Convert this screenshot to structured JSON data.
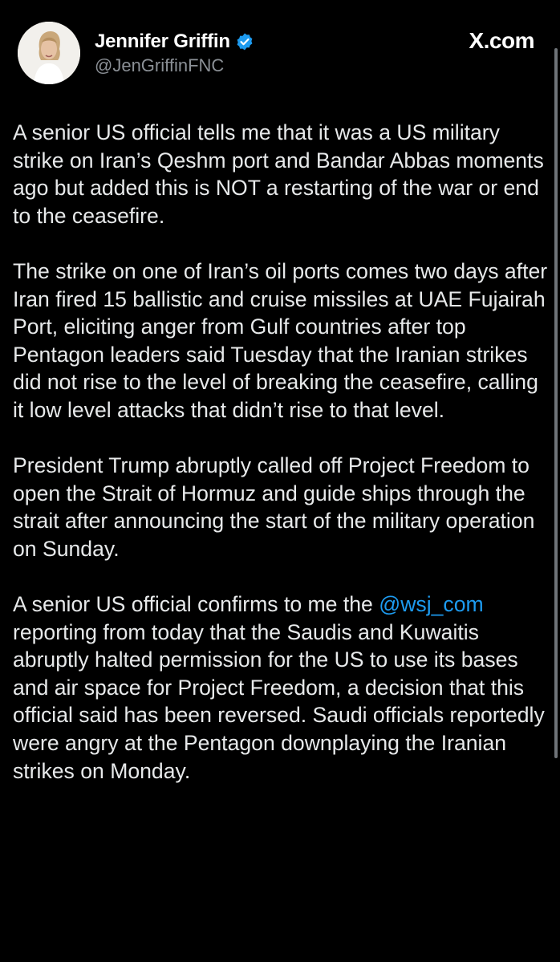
{
  "author": {
    "display_name": "Jennifer Griffin",
    "handle": "@JenGriffinFNC",
    "verified": true
  },
  "site": "X.com",
  "icons": {
    "verified": "verified-badge-icon",
    "avatar": "profile-photo"
  },
  "colors": {
    "background": "#000000",
    "text": "#e7e9ea",
    "secondary": "#8b9096",
    "link": "#1d9bf0",
    "verified": "#1d9bf0"
  },
  "tweet": {
    "p1": "A senior US official tells me that it was a US military strike on Iran’s Qeshm port and Bandar Abbas moments ago but added this is NOT a restarting of the war or end to the ceasefire.",
    "p2": "The strike on one of Iran’s oil ports comes two days after Iran fired 15 ballistic and cruise missiles at UAE Fujairah Port, eliciting anger from Gulf countries after top Pentagon leaders said Tuesday that the Iranian strikes did not rise to the level of breaking the ceasefire, calling it low level attacks that didn’t rise to that level.",
    "p3": "President Trump abruptly called off Project Freedom to open the Strait of Hormuz and guide ships through the strait after announcing the start of the military operation on Sunday.",
    "p4_before": "A senior US official confirms to me the ",
    "p4_mention": "@wsj_com",
    "p4_after": " reporting from today that the Saudis and Kuwaitis abruptly halted permission for the US to use its bases and air space for Project Freedom, a decision that this official said has been reversed. Saudi officials reportedly were angry at the Pentagon downplaying the Iranian strikes on Monday."
  }
}
